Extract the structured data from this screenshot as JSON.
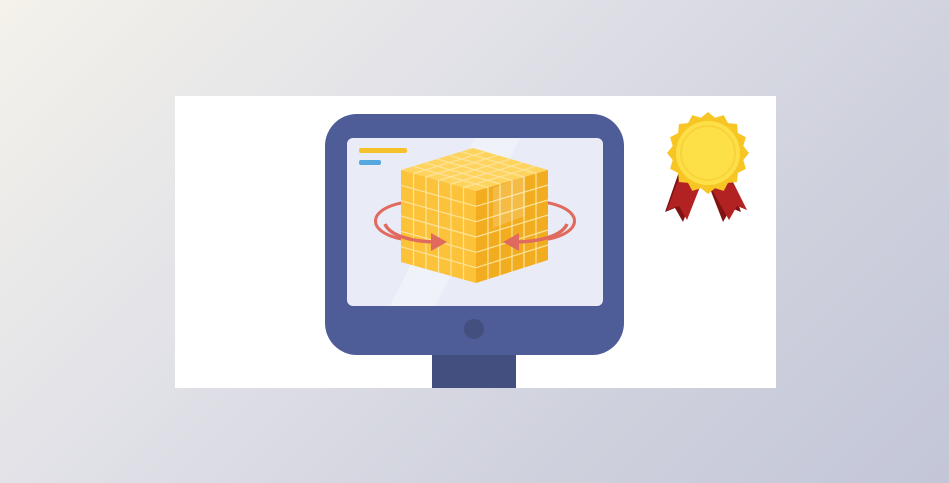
{
  "illustration": {
    "subject": "monitor-with-rotating-cube",
    "colors": {
      "background_light": "#f4f2ea",
      "background_dark": "#c3c6d8",
      "card": "#ffffff",
      "monitor_frame": "#4e5c97",
      "monitor_stand": "#43507f",
      "screen": "#e9ebf7",
      "cube_front": "#fcc23a",
      "cube_side": "#f2ac1f",
      "cube_top": "#ffd45e",
      "cube_grid": "#fbe39a",
      "arrow": "#e06a5d",
      "screen_line_yellow": "#f5c12b",
      "screen_line_blue": "#55a7e0",
      "medal_gold": "#fde047",
      "medal_rim": "#f7c624",
      "ribbon": "#b32222",
      "ribbon_dark": "#7f1313"
    },
    "icons": [
      "monitor-icon",
      "cube-icon",
      "rotate-arrows-icon",
      "award-medal-icon"
    ]
  }
}
